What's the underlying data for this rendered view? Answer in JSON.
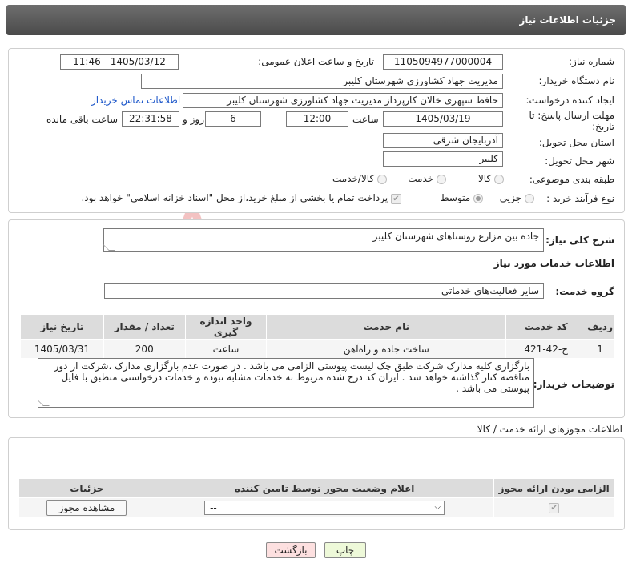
{
  "header": {
    "title": "جزئیات اطلاعات نیاز"
  },
  "info": {
    "need_number_label": "شماره نیاز:",
    "need_number": "1105094977000004",
    "announce_label": "تاریخ و ساعت اعلان عمومی:",
    "announce_value": "1405/03/12 - 11:46",
    "buyer_org_label": "نام دستگاه خریدار:",
    "buyer_org": "مدیریت جهاد کشاورزی شهرستان کلیبر",
    "creator_label": "ایجاد کننده درخواست:",
    "creator": "حافظ سپهری خالان کارپرداز مدیریت جهاد کشاورزی شهرستان کلیبر",
    "contact_link": "اطلاعات تماس خریدار",
    "deadline_label": "مهلت ارسال پاسخ: تا تاریخ:",
    "deadline_date": "1405/03/19",
    "time_label": "ساعت",
    "deadline_time": "12:00",
    "days_value": "6",
    "days_label": "روز و",
    "remaining_time": "22:31:58",
    "remaining_label": "ساعت باقی مانده",
    "province_label": "استان محل تحویل:",
    "province": "آذربایجان شرقی",
    "city_label": "شهر محل تحویل:",
    "city": "کلیبر",
    "category_label": "طبقه بندی موضوعی:",
    "category_options": [
      "کالا",
      "خدمت",
      "کالا/خدمت"
    ],
    "process_label": "نوع فرآیند خرید :",
    "process_options": [
      "جزیی",
      "متوسط"
    ],
    "payment_note": "پرداخت تمام یا بخشی از مبلغ خرید،از محل \"اسناد خزانه اسلامی\" خواهد بود."
  },
  "summary": {
    "label": "شرح کلی نیاز:",
    "value": "جاده بین مزارع روستاهای شهرستان کلیبر",
    "services_title": "اطلاعات خدمات مورد نیاز",
    "group_label": "گروه خدمت:",
    "group_value": "سایر فعالیت‌های خدماتی",
    "table": {
      "headers": [
        "ردیف",
        "کد خدمت",
        "نام خدمت",
        "واحد اندازه گیری",
        "تعداد / مقدار",
        "تاریخ نیاز"
      ],
      "rows": [
        [
          "1",
          "ج-42-421",
          "ساخت جاده و راه‌آهن",
          "ساعت",
          "200",
          "1405/03/31"
        ]
      ]
    },
    "buyer_notes_label": "توضیحات خریدار:",
    "buyer_notes": "بارگزاری کلیه مدارک شرکت طبق چک لیست پیوستی الزامی می باشد . در صورت عدم بارگزاری مدارک ،شرکت از دور مناقصه کنار گذاشته خواهد شد . ایران کد درج شده مربوط به خدمات مشابه نبوده و خدمات درخواستی منطبق با فایل پیوستی می باشد ."
  },
  "permits": {
    "title": "اطلاعات مجوزهای ارائه خدمت / کالا",
    "headers": [
      "الزامی بودن ارائه مجوز",
      "اعلام وضعیت مجوز توسط تامین کننده",
      "جزئیات"
    ],
    "select_value": "--",
    "view_button": "مشاهده مجوز"
  },
  "footer": {
    "print_button": "چاپ",
    "back_button": "بازگشت"
  },
  "watermark": "AriaTender.net",
  "colors": {
    "header": "#555555",
    "link": "#1a55c9",
    "print_bg": "#eef9d9",
    "back_bg": "#fde0e0"
  }
}
